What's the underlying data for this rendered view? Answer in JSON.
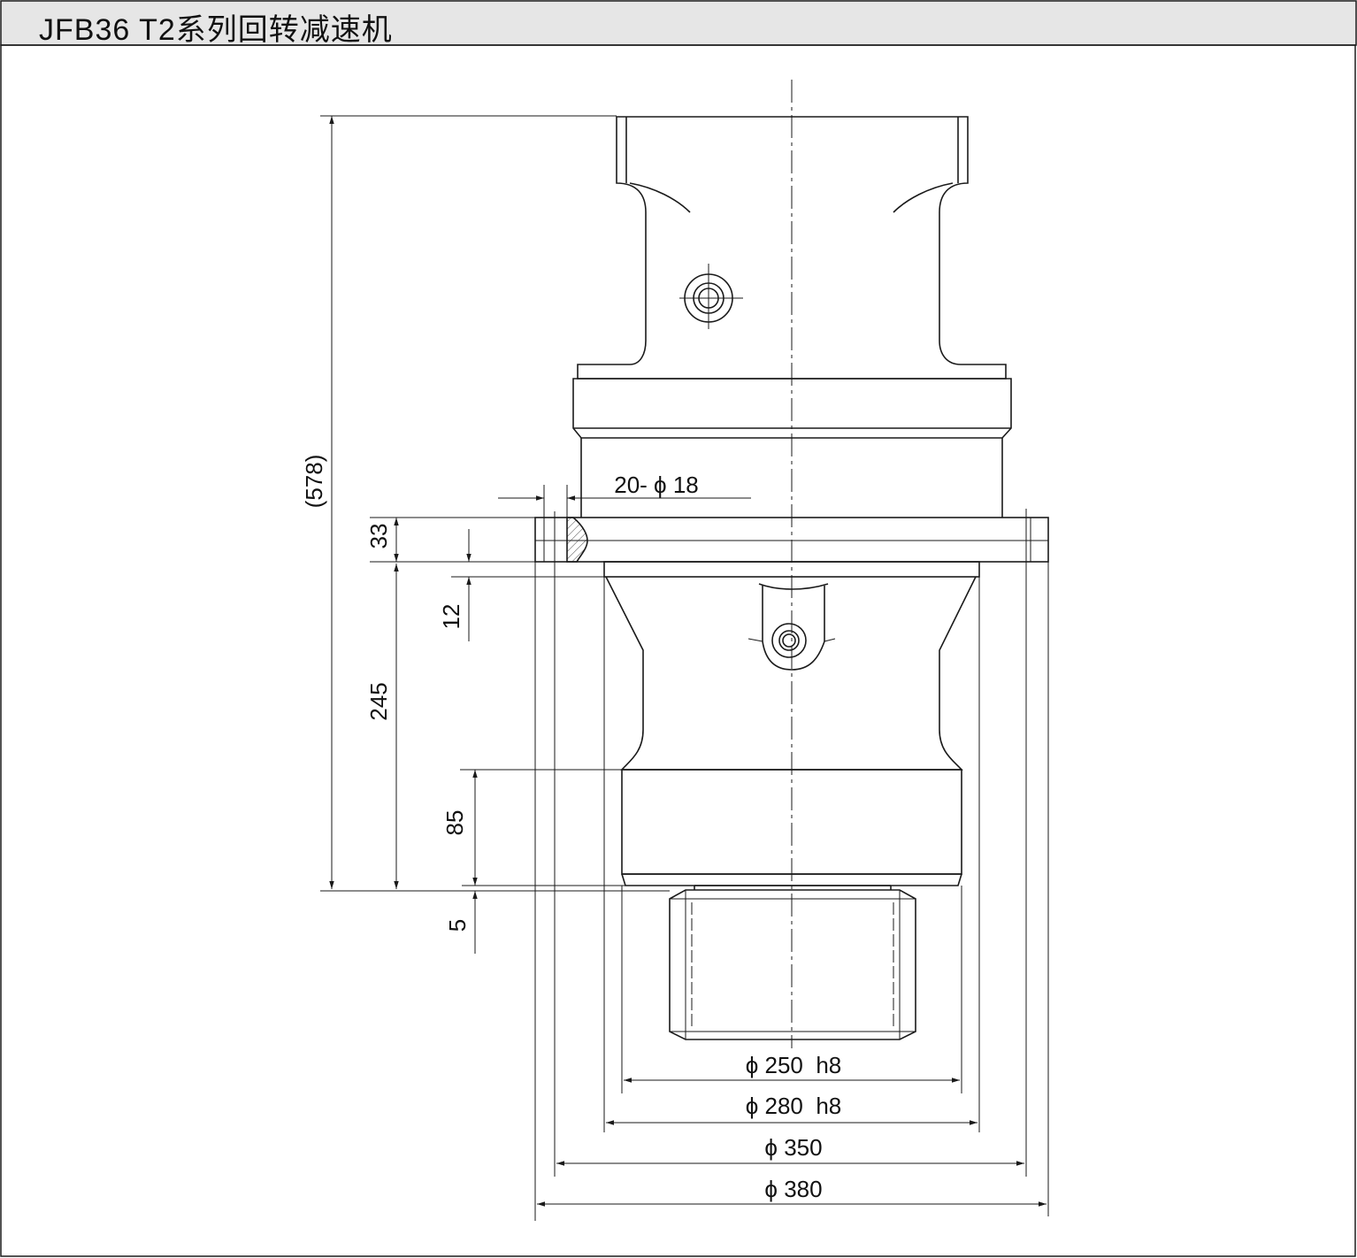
{
  "header": {
    "title": "JFB36 T2系列回转减速机"
  },
  "dimensions": {
    "overall_height": "(578)",
    "flange_thickness": "33",
    "spigot_height": "12",
    "lower_body_height": "245",
    "pinion_body_height": "85",
    "pinion_gap": "5",
    "bolt_holes": "20- ϕ 18",
    "dia_250": "ϕ 250  h8",
    "dia_280": "ϕ 280  h8",
    "dia_350": "ϕ 350",
    "dia_380": "ϕ 380"
  },
  "colors": {
    "header_bg": "#e6e6e6",
    "line": "#1a1a1a"
  }
}
